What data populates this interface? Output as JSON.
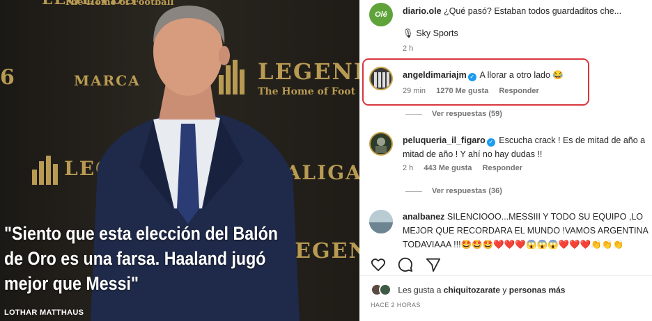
{
  "photo": {
    "backdrop": {
      "legends": "LEGENDS",
      "legends_sub": "The Home of Football",
      "legends_sub_cut": "The Home of Foot",
      "legends_left": "LEGENDS",
      "legends_bottom": "LEGEND",
      "marca": "MARCA",
      "marca_left": "MARC",
      "laliga": "LALIGA",
      "num_6": "6"
    },
    "quote": "\"Siento que esta elección del Balón de Oro es una farsa. Haaland jugó mejor que Messi\"",
    "author": "LOTHAR MATTHAUS"
  },
  "comments": [
    {
      "username": "diario.ole",
      "verified": false,
      "avatar_text": "Olé",
      "avatar_color": "#5fa33a",
      "text": "¿Qué pasó? Estaban todos guardaditos che...",
      "extra": "🎙 Sky Sports",
      "time": "2 h",
      "likes": "",
      "reply": ""
    },
    {
      "username": "angeldimariajm",
      "verified": true,
      "avatar_color": "#3a3a3a",
      "text": "A llorar a otro lado 😂",
      "time": "29 min",
      "likes": "1270 Me gusta",
      "reply": "Responder",
      "view_replies": "Ver respuestas (59)"
    },
    {
      "username": "peluqueria_il_figaro",
      "verified": true,
      "avatar_color": "#2d3b2a",
      "text": "Escucha crack ! Es de mitad de año a mitad de año ! Y ahí no hay dudas !!",
      "time": "2 h",
      "likes": "443 Me gusta",
      "reply": "Responder",
      "view_replies": "Ver respuestas (36)"
    },
    {
      "username": "analbanez",
      "verified": false,
      "avatar_color": "#8aa2ad",
      "text": "SILENCIOOO...MESSIII Y TODO SU EQUIPO ,LO MEJOR QUE RECORDARA EL MUNDO !VAMOS ARGENTINA TODAVIAAA !!!🤩🤩🤩❤️❤️❤️😱😱😱❤️❤️❤️👏👏👏"
    }
  ],
  "footer": {
    "likes_prefix": "Les gusta a ",
    "likes_user": "chiquitozarate",
    "likes_suffix": " y ",
    "likes_more": "personas más",
    "timestamp": "HACE 2 HORAS"
  },
  "icons": {
    "like": "heart-icon",
    "comment": "comment-icon",
    "share": "send-icon"
  },
  "colors": {
    "highlight": "#d9363e",
    "verified": "#1d9bf0",
    "backdrop_gold": "#b89a52"
  }
}
